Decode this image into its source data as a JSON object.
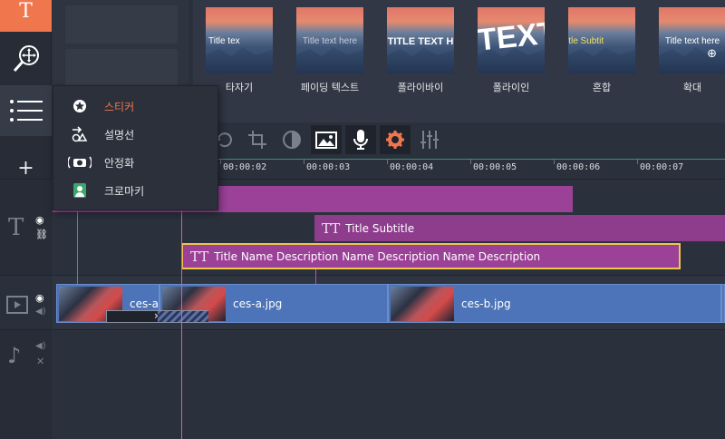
{
  "toolbar": {
    "items": [
      {
        "name": "titles-tool",
        "icon": "text-T-icon"
      },
      {
        "name": "zoom-tool",
        "icon": "zoom-move-icon"
      },
      {
        "name": "more-tools",
        "icon": "menu-list-icon"
      }
    ],
    "add_track_label": "+"
  },
  "presets": [
    {
      "label": "타자기",
      "overlay": "Title tex",
      "style": "left"
    },
    {
      "label": "페이딩 텍스트",
      "overlay": "Title text here",
      "style": "fade"
    },
    {
      "label": "폴라이바이",
      "overlay": "TITLE TEXT H",
      "style": "bold"
    },
    {
      "label": "폴라이인",
      "overlay": "TEXT",
      "style": "big"
    },
    {
      "label": "혼합",
      "overlay": "itle   Subtit",
      "style": "mixed"
    },
    {
      "label": "확대",
      "overlay": "Title text here",
      "style": "zoom"
    }
  ],
  "popup_menu": {
    "items": [
      {
        "label": "스티커",
        "icon": "sticker-icon",
        "active": true
      },
      {
        "label": "설명선",
        "icon": "callout-icon",
        "active": false
      },
      {
        "label": "안정화",
        "icon": "stabilization-icon",
        "active": false
      },
      {
        "label": "크로마키",
        "icon": "chroma-key-icon",
        "active": false
      }
    ]
  },
  "ruler": {
    "labels": [
      "00:00:02",
      "00:00:03",
      "00:00:04",
      "00:00:05",
      "00:00:06",
      "00:00:07"
    ]
  },
  "timeline": {
    "title_clips": [
      {
        "text": ""
      },
      {
        "text": "Title Subtitle"
      },
      {
        "text": "Title Name Description Name Description Name Description"
      }
    ],
    "video_clips": [
      {
        "label": "ces-a"
      },
      {
        "label": "ces-a.jpg"
      },
      {
        "label": "ces-b.jpg"
      }
    ]
  },
  "colors": {
    "accent_orange": "#f0764e",
    "title_clip": "#9b4197",
    "video_clip": "#4d74b8",
    "playhead": "#e056b0",
    "active_menu_text": "#f0764e"
  }
}
